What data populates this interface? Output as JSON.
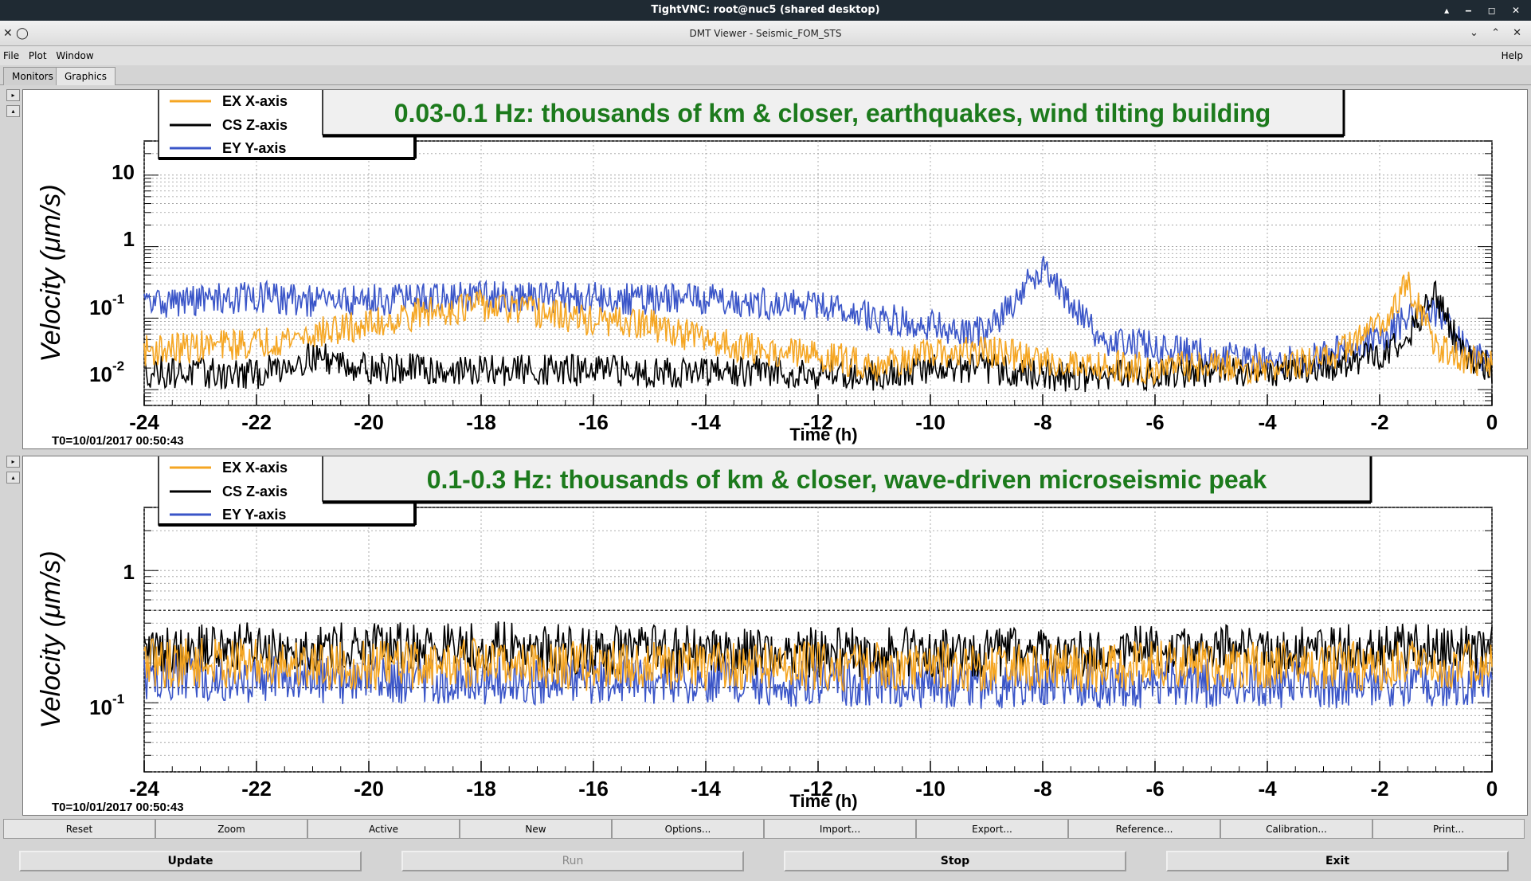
{
  "vnc": {
    "title": "TightVNC: root@nuc5 (shared desktop)"
  },
  "window": {
    "title": "DMT Viewer - Seismic_FOM_STS"
  },
  "menu": {
    "file": "File",
    "plot": "Plot",
    "window": "Window",
    "help": "Help"
  },
  "tabs": [
    "Monitors",
    "Graphics"
  ],
  "plots": [
    {
      "banner": "0.03-0.1 Hz: thousands of km & closer, earthquakes, wind tilting building",
      "ylabel_text": "Velocity  (",
      "ylabel_unit": "μm/s)",
      "xlabel": "Time (h)",
      "t0": "T0=10/01/2017 00:50:43",
      "legend": [
        "EX X-axis",
        "CS Z-axis",
        "EY Y-axis"
      ],
      "yticks": [
        "10",
        "1",
        "10",
        "10",
        "-1",
        "-2"
      ],
      "xticks": [
        "-24",
        "-22",
        "-20",
        "-18",
        "-16",
        "-14",
        "-12",
        "-10",
        "-8",
        "-6",
        "-4",
        "-2",
        "0"
      ]
    },
    {
      "banner": "0.1-0.3 Hz: thousands of km & closer, wave-driven microseismic peak",
      "ylabel_text": "Velocity  (",
      "ylabel_unit": "μm/s)",
      "xlabel": "Time (h)",
      "t0": "T0=10/01/2017 00:50:43",
      "legend": [
        "EX X-axis",
        "CS Z-axis",
        "EY Y-axis"
      ],
      "yticks": [
        "1",
        "10",
        "-1"
      ],
      "xticks": [
        "-24",
        "-22",
        "-20",
        "-18",
        "-16",
        "-14",
        "-12",
        "-10",
        "-8",
        "-6",
        "-4",
        "-2",
        "0"
      ]
    }
  ],
  "chart_data": [
    {
      "type": "line",
      "title": "0.03-0.1 Hz: thousands of km & closer, earthquakes, wind tilting building",
      "xlabel": "Time (h)",
      "ylabel": "Velocity (μm/s)",
      "xlim": [
        -24,
        0
      ],
      "ylim": [
        0.006,
        30
      ],
      "yscale": "log",
      "grid": true,
      "legend_position": "top-left",
      "x": [
        -24,
        -23,
        -22,
        -21,
        -20,
        -19,
        -18,
        -17,
        -16,
        -15,
        -14,
        -13,
        -12,
        -11,
        -10,
        -9,
        -8,
        -7,
        -6,
        -5,
        -4,
        -3,
        -2,
        -1.5,
        -1,
        -0.5,
        0
      ],
      "series": [
        {
          "name": "EX X-axis",
          "color": "#f5a623",
          "values": [
            0.035,
            0.04,
            0.045,
            0.06,
            0.08,
            0.12,
            0.15,
            0.12,
            0.09,
            0.08,
            0.05,
            0.035,
            0.03,
            0.022,
            0.03,
            0.035,
            0.025,
            0.022,
            0.02,
            0.022,
            0.02,
            0.025,
            0.08,
            0.3,
            0.04,
            0.025,
            0.022
          ]
        },
        {
          "name": "CS Z-axis",
          "color": "#000000",
          "values": [
            0.018,
            0.017,
            0.016,
            0.03,
            0.02,
            0.019,
            0.018,
            0.019,
            0.018,
            0.018,
            0.017,
            0.018,
            0.017,
            0.016,
            0.02,
            0.02,
            0.016,
            0.015,
            0.017,
            0.018,
            0.018,
            0.02,
            0.03,
            0.06,
            0.2,
            0.03,
            0.02
          ]
        },
        {
          "name": "EY Y-axis",
          "color": "#3a55c8",
          "values": [
            0.16,
            0.18,
            0.2,
            0.17,
            0.18,
            0.19,
            0.2,
            0.2,
            0.19,
            0.18,
            0.19,
            0.16,
            0.15,
            0.1,
            0.08,
            0.06,
            0.55,
            0.05,
            0.04,
            0.03,
            0.025,
            0.03,
            0.05,
            0.1,
            0.12,
            0.04,
            0.025
          ]
        }
      ]
    },
    {
      "type": "line",
      "title": "0.1-0.3 Hz: thousands of km & closer, wave-driven microseismic peak",
      "xlabel": "Time (h)",
      "ylabel": "Velocity (μm/s)",
      "xlim": [
        -24,
        0
      ],
      "ylim": [
        0.03,
        3
      ],
      "yscale": "log",
      "grid": true,
      "legend_position": "top-left",
      "x": [
        -24,
        -22,
        -20,
        -18,
        -16,
        -14,
        -12,
        -10,
        -8,
        -6,
        -4,
        -2,
        0
      ],
      "series": [
        {
          "name": "EX X-axis",
          "color": "#f5a623",
          "values": [
            0.2,
            0.2,
            0.19,
            0.2,
            0.19,
            0.19,
            0.19,
            0.19,
            0.18,
            0.19,
            0.19,
            0.19,
            0.2
          ]
        },
        {
          "name": "CS Z-axis",
          "color": "#000000",
          "values": [
            0.25,
            0.27,
            0.26,
            0.27,
            0.25,
            0.25,
            0.24,
            0.24,
            0.24,
            0.25,
            0.25,
            0.26,
            0.25
          ]
        },
        {
          "name": "EY Y-axis",
          "color": "#3a55c8",
          "values": [
            0.16,
            0.15,
            0.15,
            0.15,
            0.15,
            0.15,
            0.14,
            0.14,
            0.14,
            0.14,
            0.14,
            0.14,
            0.15
          ]
        }
      ],
      "reference_lines": [
        0.5,
        0.13
      ]
    }
  ],
  "buttons_row1": [
    "Reset",
    "Zoom",
    "Active",
    "New",
    "Options...",
    "Import...",
    "Export...",
    "Reference...",
    "Calibration...",
    "Print..."
  ],
  "buttons_row2": [
    "Update",
    "Run",
    "Stop",
    "Exit"
  ]
}
